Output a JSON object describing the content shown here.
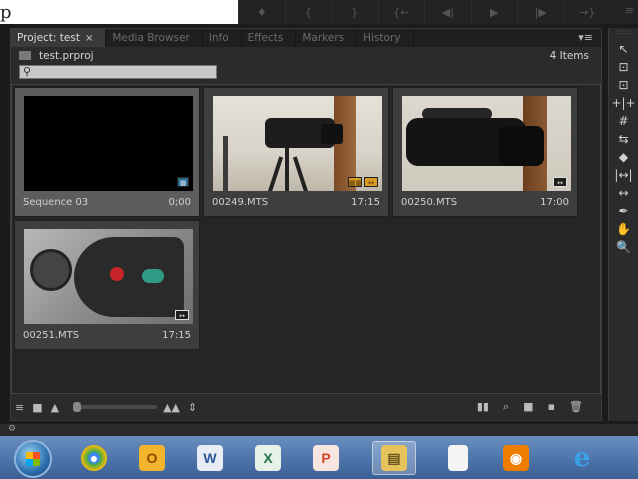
{
  "top_strip": {
    "cut_glyph": "p",
    "transport": [
      "♦",
      "{",
      "}",
      "{←",
      "◀|",
      "▶",
      "|▶",
      "→}"
    ],
    "right_glyph": "≡"
  },
  "tabs": [
    {
      "label": "Project: test",
      "close": "×",
      "active": true
    },
    {
      "label": "Media Browser"
    },
    {
      "label": "Info"
    },
    {
      "label": "Effects"
    },
    {
      "label": "Markers"
    },
    {
      "label": "History"
    }
  ],
  "panel_menu": "▾≡",
  "project": {
    "name": "test.prproj",
    "item_count": "4 Items",
    "search_icon": "search-icon"
  },
  "clips": [
    {
      "name": "Sequence 03",
      "duration": "0;00"
    },
    {
      "name": "00249.MTS",
      "duration": "17:15"
    },
    {
      "name": "00250.MTS",
      "duration": "17:00"
    },
    {
      "name": "00251.MTS",
      "duration": "17:15"
    }
  ],
  "badges": {
    "sequence": "▦",
    "video": "▦▦",
    "audio": "↔"
  },
  "bottom_bar": {
    "list_view": "≡",
    "icon_view": "■",
    "zoom_small": "▲",
    "zoom_large": "▲▲",
    "sort": "⇕",
    "automate": "▮▮",
    "find": "⌕",
    "new_bin": "■",
    "new_item": "▪",
    "clear": "🗑"
  },
  "tools": [
    "↖",
    "⊡",
    "⊡",
    "+|+",
    "#",
    "⇆",
    "◆",
    "|↔|",
    "↔",
    "✒",
    "✋",
    "🔍"
  ],
  "status_icon": "⚙",
  "taskbar": {
    "items": [
      {
        "name": "chrome",
        "glyph": "●",
        "color": "#e8b02a"
      },
      {
        "name": "outlook",
        "glyph": "O",
        "color": "#e8a020"
      },
      {
        "name": "word",
        "glyph": "W",
        "color": "#2b579a"
      },
      {
        "name": "excel",
        "glyph": "X",
        "color": "#217346"
      },
      {
        "name": "powerpoint",
        "glyph": "P",
        "color": "#d24726"
      },
      {
        "name": "explorer",
        "glyph": "▤",
        "color": "#e7c35c"
      },
      {
        "name": "document",
        "glyph": "",
        "color": "#f4f4f4"
      },
      {
        "name": "media",
        "glyph": "◉",
        "color": "#ef7d00"
      },
      {
        "name": "ie",
        "glyph": "e",
        "color": "#3aa0e8"
      }
    ]
  }
}
